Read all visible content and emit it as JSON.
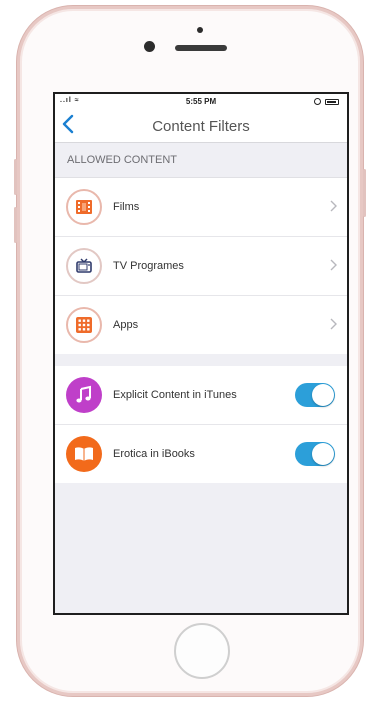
{
  "status_bar": {
    "signal": "..ıl ≈",
    "time": "5:55 PM"
  },
  "nav": {
    "back_icon": "chevron-left-icon",
    "title": "Content Filters"
  },
  "allowed_content": {
    "header": "ALLOWED CONTENT",
    "items": [
      {
        "label": "Films",
        "icon": "film-icon"
      },
      {
        "label": "TV Programes",
        "icon": "tv-icon"
      },
      {
        "label": "Apps",
        "icon": "apps-grid-icon"
      }
    ]
  },
  "toggles": [
    {
      "label": "Explicit Content in iTunes",
      "icon": "music-note-icon",
      "on": true,
      "color": "#bf3fc9"
    },
    {
      "label": "Erotica in iBooks",
      "icon": "book-icon",
      "on": true,
      "color": "#f26a1b"
    }
  ],
  "colors": {
    "accent": "#2c9fd9",
    "nav_back": "#1a7fd1",
    "icon_orange": "#ef6b2a",
    "icon_navy": "#2f3a6b"
  }
}
